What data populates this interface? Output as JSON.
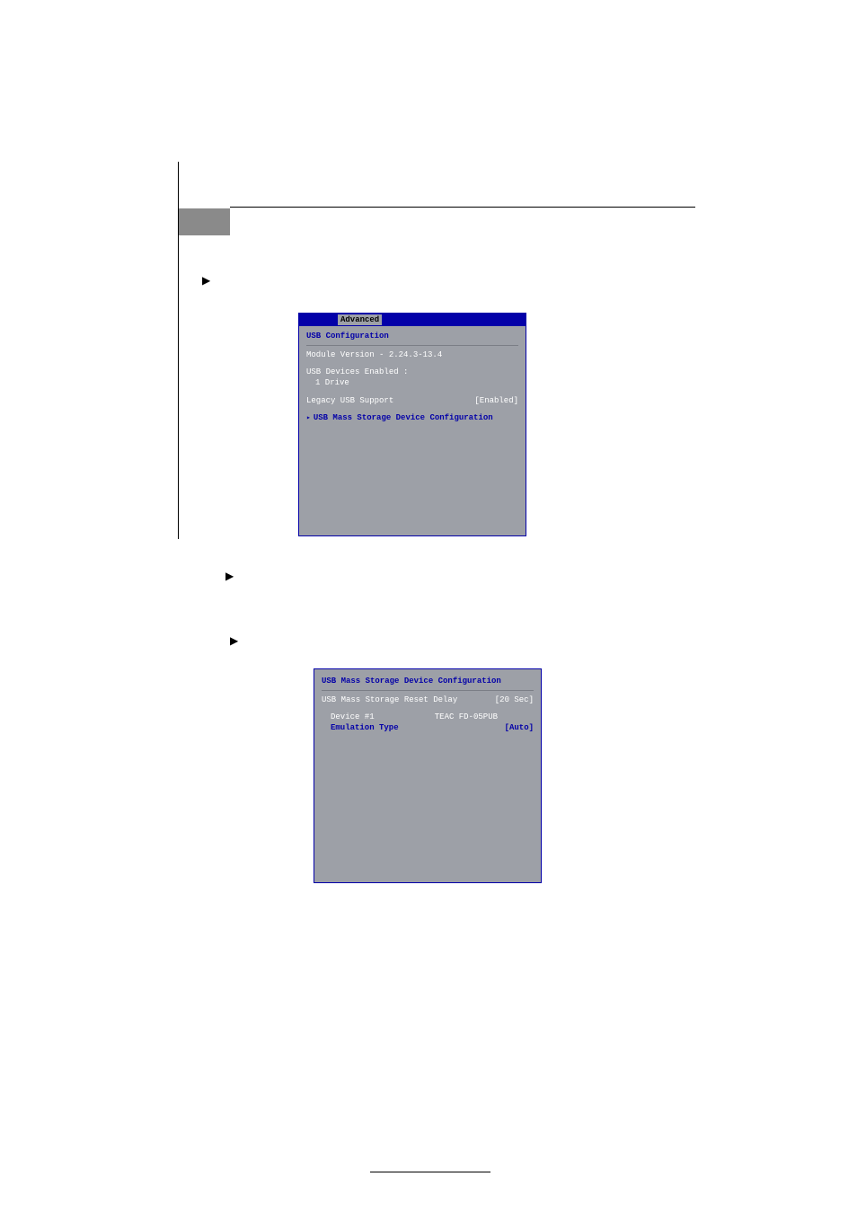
{
  "bullets": {
    "usb_config": "",
    "legacy_usb": "",
    "mass_storage": ""
  },
  "bios1": {
    "tab": "Advanced",
    "title": "USB Configuration",
    "module_version": "Module Version - 2.24.3-13.4",
    "devices_label": "USB Devices Enabled :",
    "devices_value": "1 Drive",
    "legacy_label": "Legacy USB Support",
    "legacy_value": "[Enabled]",
    "submenu": "USB Mass Storage Device Configuration"
  },
  "bios2": {
    "title": "USB Mass Storage Device Configuration",
    "reset_label": "USB Mass Storage Reset Delay",
    "reset_value": "[20 Sec]",
    "device_label": "Device #1",
    "device_value": "TEAC FD-05PUB",
    "emu_label": "Emulation Type",
    "emu_value": "[Auto]"
  }
}
